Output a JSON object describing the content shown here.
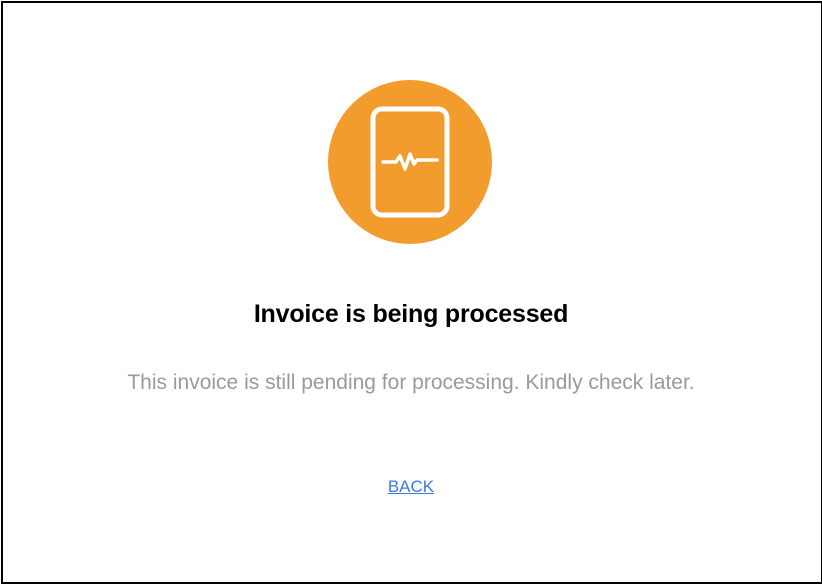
{
  "status": {
    "icon": "tablet-pulse-icon",
    "accent_color": "#f29c2d",
    "title": "Invoice is being processed",
    "message": "This invoice is still pending for processing. Kindly check later."
  },
  "actions": {
    "back_label": "BACK",
    "link_color": "#3a7be0"
  }
}
